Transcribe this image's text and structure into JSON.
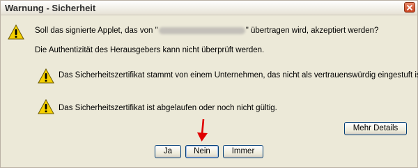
{
  "window": {
    "title": "Warnung - Sicherheit"
  },
  "message": {
    "question_prefix": "Soll das signierte Applet, das von \"",
    "question_suffix": "\" übertragen wird, akzeptiert werden?",
    "authenticity": "Die Authentizität des Herausgebers kann nicht überprüft werden."
  },
  "warnings": [
    {
      "text": "Das Sicherheitszertifikat stammt von einem Unternehmen, das nicht als vertrauenswürdig eingestuft ist."
    },
    {
      "text": "Das Sicherheitszertifikat ist abgelaufen oder noch nicht gültig."
    }
  ],
  "buttons": {
    "details": "Mehr Details",
    "yes": "Ja",
    "no": "Nein",
    "always": "Immer"
  },
  "colors": {
    "dialog_bg": "#ece9d8",
    "close_red": "#c8421e",
    "warning_yellow": "#f5d000",
    "arrow_red": "#e00000"
  }
}
